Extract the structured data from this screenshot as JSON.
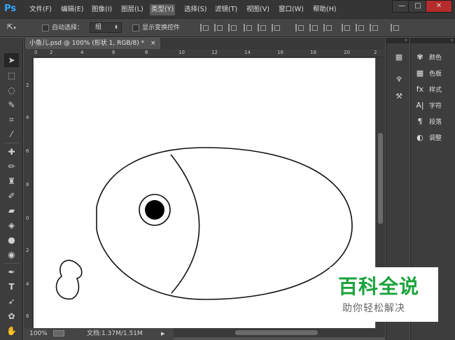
{
  "app": {
    "logo": "Ps"
  },
  "menu": [
    {
      "id": "file",
      "label": "文件(F)"
    },
    {
      "id": "edit",
      "label": "编辑(E)"
    },
    {
      "id": "image",
      "label": "图像(I)"
    },
    {
      "id": "layer",
      "label": "图层(L)"
    },
    {
      "id": "type",
      "label": "类型(Y)"
    },
    {
      "id": "select",
      "label": "选择(S)"
    },
    {
      "id": "filter",
      "label": "滤镜(T)"
    },
    {
      "id": "view",
      "label": "视图(V)"
    },
    {
      "id": "window",
      "label": "窗口(W)"
    },
    {
      "id": "help",
      "label": "帮助(H)"
    }
  ],
  "menu_active": "type",
  "window_controls": {
    "minimize": "—",
    "restore": "□",
    "close": "✕"
  },
  "options": {
    "auto_select_label": "自动选择：",
    "auto_select_value": "组",
    "show_transform_label": "显示变换控件"
  },
  "document": {
    "tab_title": "小鱼儿.psd @ 100% (形状 1, RGB/8) *",
    "tab_close": "×"
  },
  "ruler": {
    "top_labels": [
      "0",
      "2",
      "4",
      "6",
      "8",
      "10",
      "12",
      "14",
      "16",
      "18",
      "20",
      "2"
    ],
    "left_labels": [
      "2",
      "4",
      "6",
      "8",
      "0",
      "2",
      "4",
      "6"
    ]
  },
  "status": {
    "zoom": "100%",
    "doc_size": "文档:1.37M/1.51M",
    "arrow": "▶"
  },
  "panels": {
    "collapse_glyph": "«",
    "items": [
      {
        "id": "color",
        "label": "颜色",
        "icon": "palette-icon"
      },
      {
        "id": "swatches",
        "label": "色板",
        "icon": "swatches-icon"
      },
      {
        "id": "styles",
        "label": "样式",
        "icon": "styles-icon"
      },
      {
        "id": "character",
        "label": "字符",
        "icon": "character-icon"
      },
      {
        "id": "paragraph",
        "label": "段落",
        "icon": "paragraph-icon"
      },
      {
        "id": "adjustments",
        "label": "调整",
        "icon": "adjustments-icon"
      }
    ]
  },
  "watermark": {
    "title": "百科全说",
    "subtitle": "助你轻松解决"
  },
  "colors": {
    "accent": "#31a8ff",
    "watermark_green": "#1aa33c",
    "canvas": "#ffffff"
  }
}
